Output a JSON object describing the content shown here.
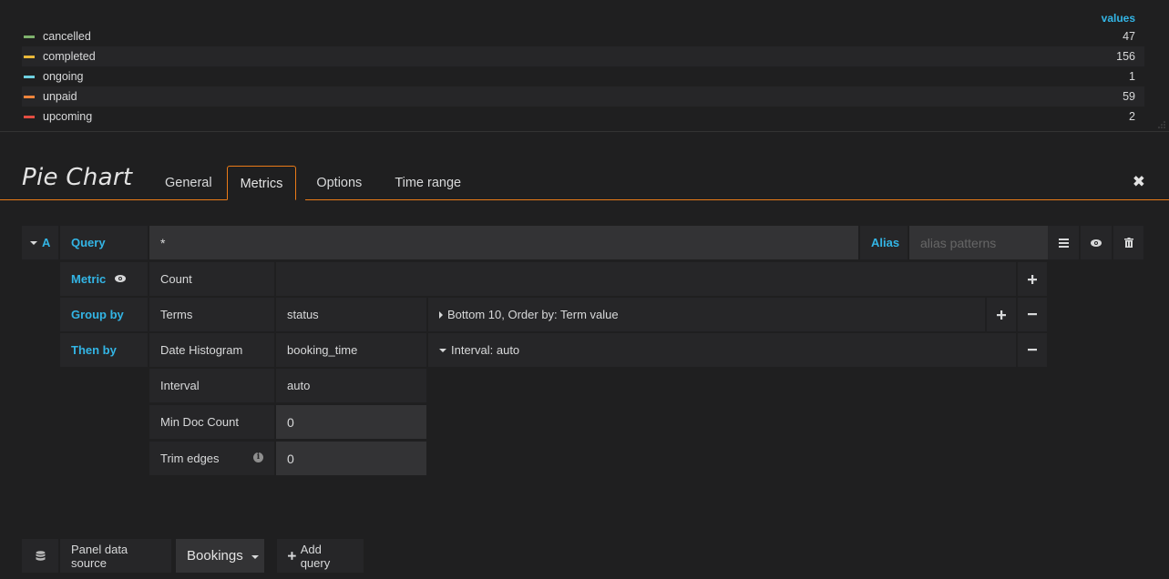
{
  "legend": {
    "header": "values",
    "rows": [
      {
        "label": "cancelled",
        "value": "47",
        "color": "#7eb26d"
      },
      {
        "label": "completed",
        "value": "156",
        "color": "#eab839"
      },
      {
        "label": "ongoing",
        "value": "1",
        "color": "#6ed0e0"
      },
      {
        "label": "unpaid",
        "value": "59",
        "color": "#ef843c"
      },
      {
        "label": "upcoming",
        "value": "2",
        "color": "#e24d42"
      }
    ]
  },
  "editor": {
    "title": "Pie Chart",
    "tabs": [
      "General",
      "Metrics",
      "Options",
      "Time range"
    ],
    "active_tab": "Metrics"
  },
  "query": {
    "ref_id": "A",
    "query_label": "Query",
    "query_value": "*",
    "alias_label": "Alias",
    "alias_placeholder": "alias patterns"
  },
  "metric": {
    "label": "Metric",
    "type": "Count"
  },
  "group_by": {
    "label": "Group by",
    "type": "Terms",
    "field": "status",
    "options": "Bottom 10, Order by: Term value"
  },
  "then_by": {
    "label": "Then by",
    "type": "Date Histogram",
    "field": "booking_time",
    "options": "Interval: auto",
    "settings": [
      {
        "label": "Interval",
        "value": "auto"
      },
      {
        "label": "Min Doc Count",
        "value": "0"
      },
      {
        "label": "Trim edges",
        "value": "0"
      }
    ]
  },
  "bottom": {
    "panel_data_source_label": "Panel data source",
    "data_source": "Bookings",
    "add_query": "Add query"
  },
  "colors": {
    "accent": "#eb7b18",
    "label_blue": "#33b5e5"
  }
}
